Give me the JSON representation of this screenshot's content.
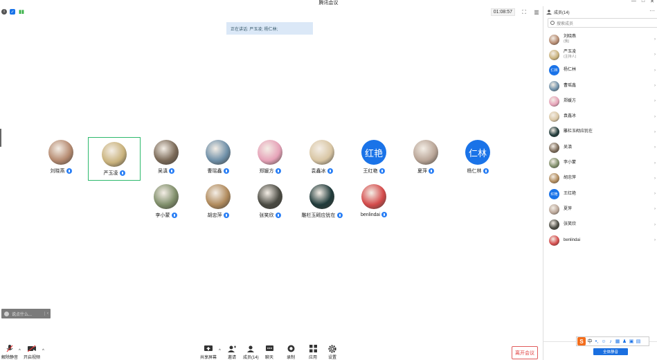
{
  "window": {
    "title": "腾讯会议",
    "controls": [
      "—",
      "□",
      "✕"
    ]
  },
  "topbar": {
    "timer": "01:08:57"
  },
  "speaking_banner": "正在讲话: 严玉凌; 杨仁林;",
  "participants": [
    {
      "name": "刘晓燕",
      "avatar_text": "",
      "color": "#b58a70",
      "style": "a1"
    },
    {
      "name": "严玉凌",
      "avatar_text": "",
      "color": "#c9b27c",
      "style": "a2",
      "active": true
    },
    {
      "name": "吴滇",
      "avatar_text": "",
      "color": "#7b6a58",
      "style": "a3"
    },
    {
      "name": "曹瑶鑫",
      "avatar_text": "",
      "color": "#6e8fa8",
      "style": "a4"
    },
    {
      "name": "郑媛方",
      "avatar_text": "",
      "color": "#e6a2b8",
      "style": "a5"
    },
    {
      "name": "袁鑫冰",
      "avatar_text": "",
      "color": "#d9c6a4",
      "style": "a6"
    },
    {
      "name": "王红艳",
      "avatar_text": "红艳",
      "color": "#1a73e8",
      "style": "solid"
    },
    {
      "name": "夏萍",
      "avatar_text": "",
      "color": "#b9a597",
      "style": "a8"
    },
    {
      "name": "杨仁林",
      "avatar_text": "仁林",
      "color": "#1a73e8",
      "style": "solid"
    },
    {
      "name": "李小蒙",
      "avatar_text": "",
      "color": "#7f8e6a",
      "style": "a10"
    },
    {
      "name": "胡忠萍",
      "avatar_text": "",
      "color": "#b08a5c",
      "style": "a11"
    },
    {
      "name": "张笑欣",
      "avatar_text": "",
      "color": "#4a4a42",
      "style": "a12"
    },
    {
      "name": "雕栏玉砌应犹在",
      "avatar_text": "",
      "color": "#1f3a3a",
      "style": "a13"
    },
    {
      "name": "benlindai",
      "avatar_text": "",
      "color": "#d44b4b",
      "style": "a14"
    }
  ],
  "chat": {
    "placeholder": "说点什么...",
    "close": "‹"
  },
  "toolbar": {
    "mute": "解除静音",
    "video": "开启视频",
    "share": "共享屏幕",
    "invite": "邀请",
    "members": "成员(14)",
    "chat": "聊天",
    "record": "录制",
    "apps": "应用",
    "settings": "设置",
    "end": "离开会议"
  },
  "side": {
    "title": "成员(14)",
    "search_placeholder": "搜索成员",
    "members": [
      {
        "name": "刘晓燕",
        "role": "(我)",
        "color": "#b58a70",
        "avatar_text": ""
      },
      {
        "name": "严玉凌",
        "role": "(主持人)",
        "color": "#c9b27c",
        "avatar_text": ""
      },
      {
        "name": "杨仁林",
        "role": "",
        "color": "#1a73e8",
        "avatar_text": "仁林"
      },
      {
        "name": "曹瑶鑫",
        "role": "",
        "color": "#6e8fa8",
        "avatar_text": ""
      },
      {
        "name": "郑媛方",
        "role": "",
        "color": "#e6a2b8",
        "avatar_text": ""
      },
      {
        "name": "袁鑫冰",
        "role": "",
        "color": "#d9c6a4",
        "avatar_text": ""
      },
      {
        "name": "雕栏玉砌应犹在",
        "role": "",
        "color": "#1f3a3a",
        "avatar_text": ""
      },
      {
        "name": "吴滇",
        "role": "",
        "color": "#7b6a58",
        "avatar_text": ""
      },
      {
        "name": "李小蒙",
        "role": "",
        "color": "#7f8e6a",
        "avatar_text": ""
      },
      {
        "name": "胡忠萍",
        "role": "",
        "color": "#b08a5c",
        "avatar_text": ""
      },
      {
        "name": "王红艳",
        "role": "",
        "color": "#1a73e8",
        "avatar_text": "红艳"
      },
      {
        "name": "夏萍",
        "role": "",
        "color": "#b9a597",
        "avatar_text": ""
      },
      {
        "name": "张笑欣",
        "role": "",
        "color": "#4a4a42",
        "avatar_text": ""
      },
      {
        "name": "benlindai",
        "role": "",
        "color": "#d44b4b",
        "avatar_text": ""
      }
    ],
    "mute_all": "全体静音"
  },
  "ime": {
    "logo": "S",
    "lang": "中"
  }
}
